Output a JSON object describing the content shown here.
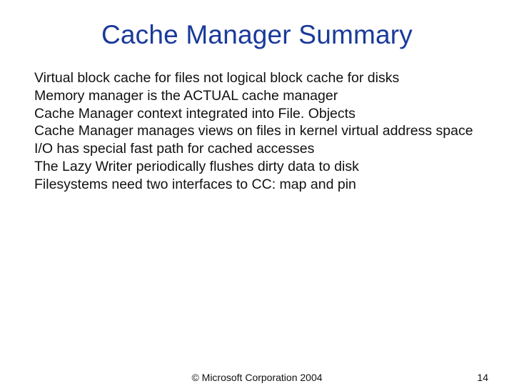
{
  "title": "Cache Manager Summary",
  "bullets": [
    "Virtual block cache for files not logical block cache for disks",
    "Memory manager is the ACTUAL cache manager",
    "Cache Manager context integrated into File. Objects",
    "Cache Manager manages views on files in kernel virtual address space",
    "I/O has special fast path for cached accesses",
    "The Lazy Writer periodically flushes dirty data to disk",
    "Filesystems need two interfaces to CC: map and pin"
  ],
  "footer": {
    "copyright": "© Microsoft Corporation 2004",
    "page_number": "14"
  }
}
